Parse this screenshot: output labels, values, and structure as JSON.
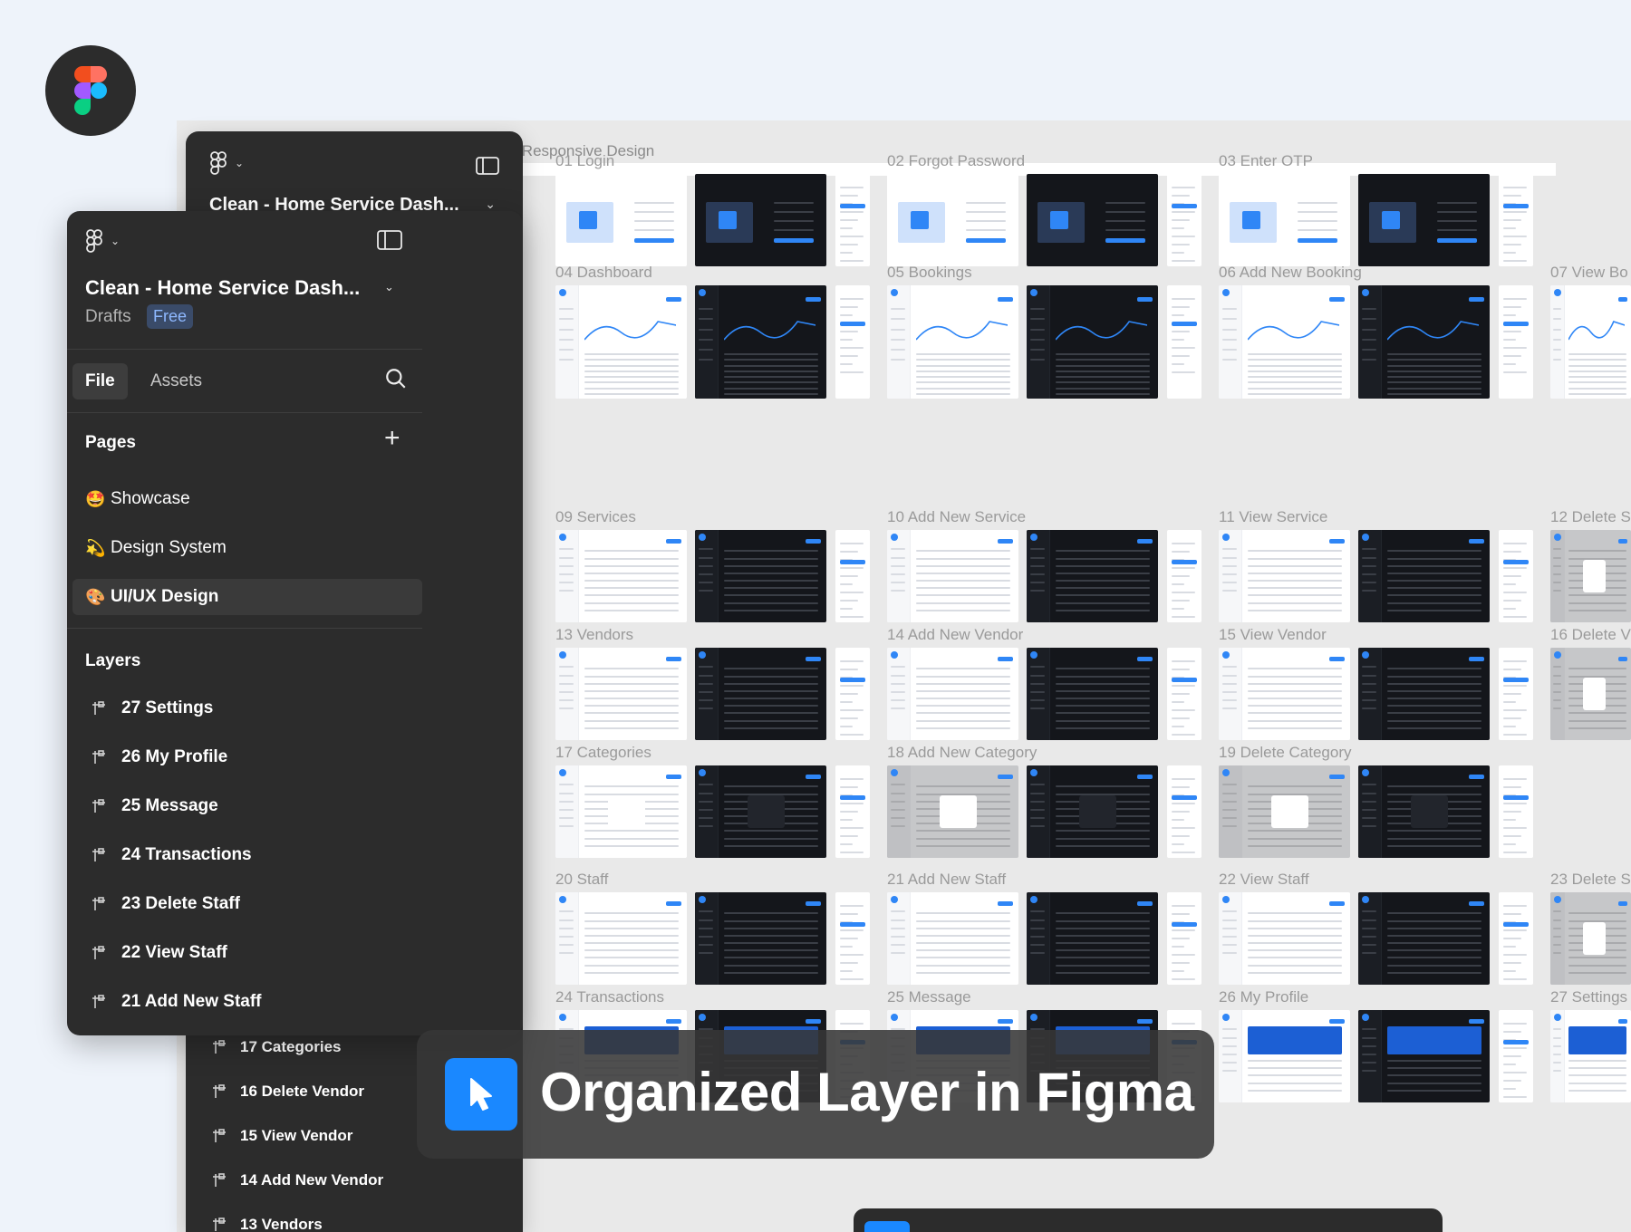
{
  "canvas": {
    "section_title": "Light, Dark & Mobile Responsive Design",
    "strip_label": "Light, Dark & Mobile Responsive Design",
    "frames": [
      "01 Login",
      "02 Forgot Password",
      "03 Enter OTP",
      "04 Dashboard",
      "05 Bookings",
      "06 Add New Booking",
      "07 View Bo",
      "09 Services",
      "10 Add New Service",
      "11 View Service",
      "12 Delete S",
      "13 Vendors",
      "14 Add New Vendor",
      "15 View Vendor",
      "16 Delete V",
      "17 Categories",
      "18 Add New Category",
      "19 Delete Category",
      "20 Staff",
      "21 Add New Staff",
      "22 View Staff",
      "23 Delete S",
      "24 Transactions",
      "25 Message",
      "26 My Profile",
      "27 Settings"
    ]
  },
  "panel_back": {
    "title": "Clean - Home Service Dash...",
    "layers": [
      "17 Categories",
      "16 Delete Vendor",
      "15 View Vendor",
      "14 Add New Vendor",
      "13 Vendors"
    ]
  },
  "panel_front": {
    "title": "Clean - Home Service Dash...",
    "location": "Drafts",
    "plan_badge": "Free",
    "tabs": {
      "file": "File",
      "assets": "Assets"
    },
    "pages_heading": "Pages",
    "pages": [
      {
        "emoji": "🤩",
        "label": "Showcase",
        "active": false
      },
      {
        "emoji": "💫",
        "label": "Design System",
        "active": false
      },
      {
        "emoji": "🎨",
        "label": "UI/UX Design",
        "active": true
      }
    ],
    "layers_heading": "Layers",
    "layers": [
      "27 Settings",
      "26 My Profile",
      "25 Message",
      "24 Transactions",
      "23 Delete Staff",
      "22 View Staff",
      "21 Add New Staff"
    ]
  },
  "banner": {
    "text": "Organized Layer in Figma",
    "icon": "cursor-arrow-icon"
  },
  "colors": {
    "accent": "#1A88FF",
    "panel": "#2C2C2C",
    "background": "#EEF3FA"
  }
}
